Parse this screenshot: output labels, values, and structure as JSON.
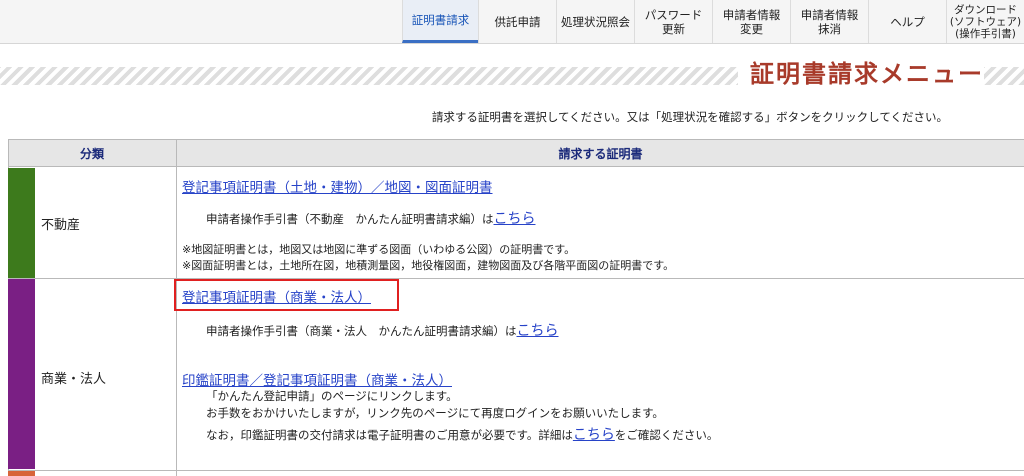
{
  "nav": {
    "items": [
      {
        "label": "証明書請求"
      },
      {
        "label": "供託申請"
      },
      {
        "label": "処理状況照会"
      },
      {
        "label": "パスワード\n更新"
      },
      {
        "label": "申請者情報\n変更"
      },
      {
        "label": "申請者情報\n抹消"
      },
      {
        "label": "ヘルプ"
      },
      {
        "label": "ダウンロード\n(ソフトウェア)\n(操作手引書)"
      }
    ]
  },
  "page": {
    "title": "証明書請求メニュー",
    "instruction": "請求する証明書を選択してください。又は「処理状況を確認する」ボタンをクリックしてください。"
  },
  "table": {
    "headers": {
      "category": "分類",
      "certificate": "請求する証明書"
    },
    "rows": [
      {
        "category": "不動産",
        "color": "#3d7a1c",
        "main_link": "登記事項証明書（土地・建物）／地図・図面証明書",
        "guide_text": "申請者操作手引書（不動産　かんたん証明書請求編）は",
        "guide_link": "こちら",
        "notes": [
          "※地図証明書とは，地図又は地図に準ずる図面（いわゆる公図）の証明書です。",
          "※図面証明書とは，土地所在図，地積測量図，地役権図面，建物図面及び各階平面図の証明書です。"
        ]
      },
      {
        "category": "商業・法人",
        "color": "#7a1f84",
        "main_link": "登記事項証明書（商業・法人）",
        "guide_text": "申請者操作手引書（商業・法人　かんたん証明書請求編）は",
        "guide_link": "こちら",
        "second_link": "印鑑証明書／登記事項証明書（商業・法人）",
        "lines": [
          "「かんたん登記申請」のページにリンクします。",
          "お手数をおかけいたしますが，リンク先のページにて再度ログインをお願いいたします。"
        ],
        "last_text_before": "なお，印鑑証明書の交付請求は電子証明書のご用意が必要です。詳細は",
        "last_link": "こちら",
        "last_text_after": "をご確認ください。"
      }
    ],
    "third_band_color": "#d8643a"
  }
}
